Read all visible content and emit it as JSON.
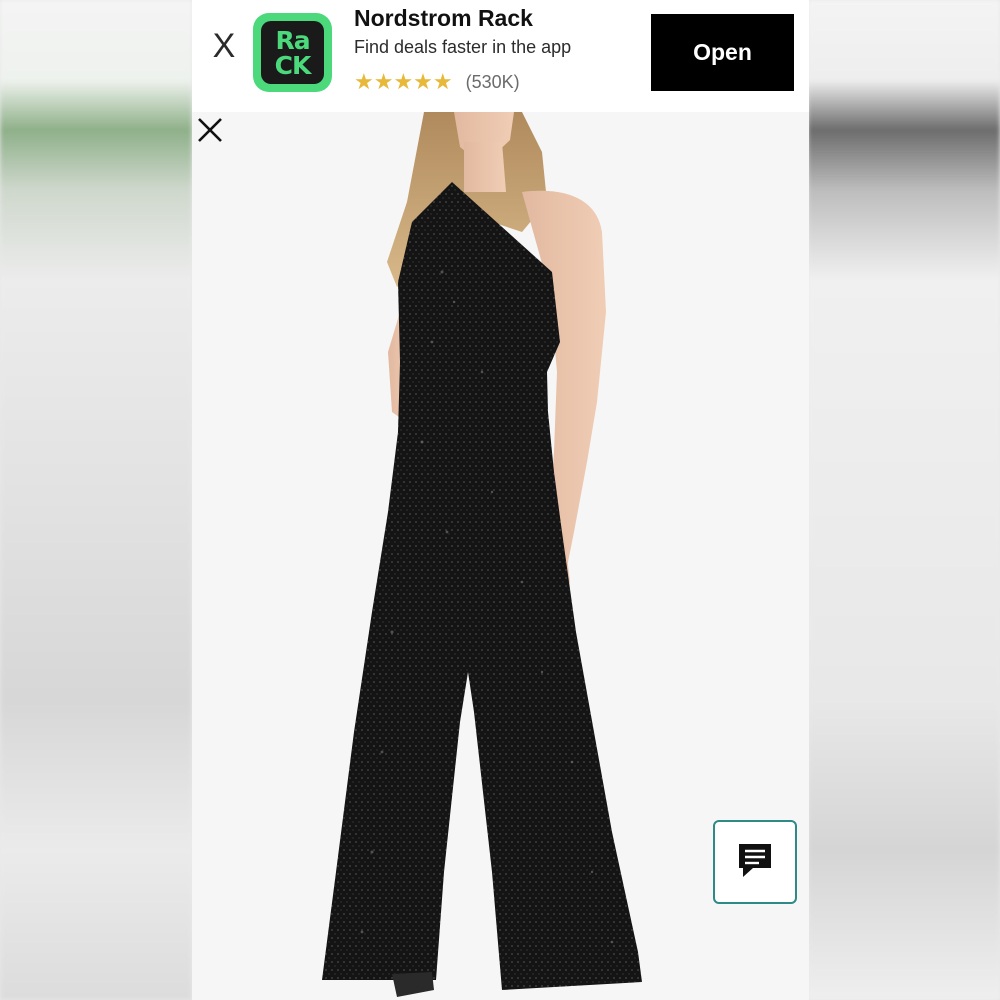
{
  "banner": {
    "close_label": "X",
    "app_icon_text_line1": "Ra",
    "app_icon_text_line2": "CK",
    "app_name": "Nordstrom Rack",
    "tagline": "Find deals faster in the app",
    "stars": "★★★★★",
    "rating_count": "(530K)",
    "open_label": "Open"
  },
  "viewer": {
    "close_icon": "close-icon",
    "image_subject": "model wearing one-shoulder black sequin wide-leg jumpsuit"
  },
  "chat": {
    "icon": "chat-bubble-icon"
  },
  "colors": {
    "brand_green": "#4bd97b",
    "button_black": "#000000",
    "star_gold": "#e7b83a",
    "chat_border": "#2f8a86"
  }
}
